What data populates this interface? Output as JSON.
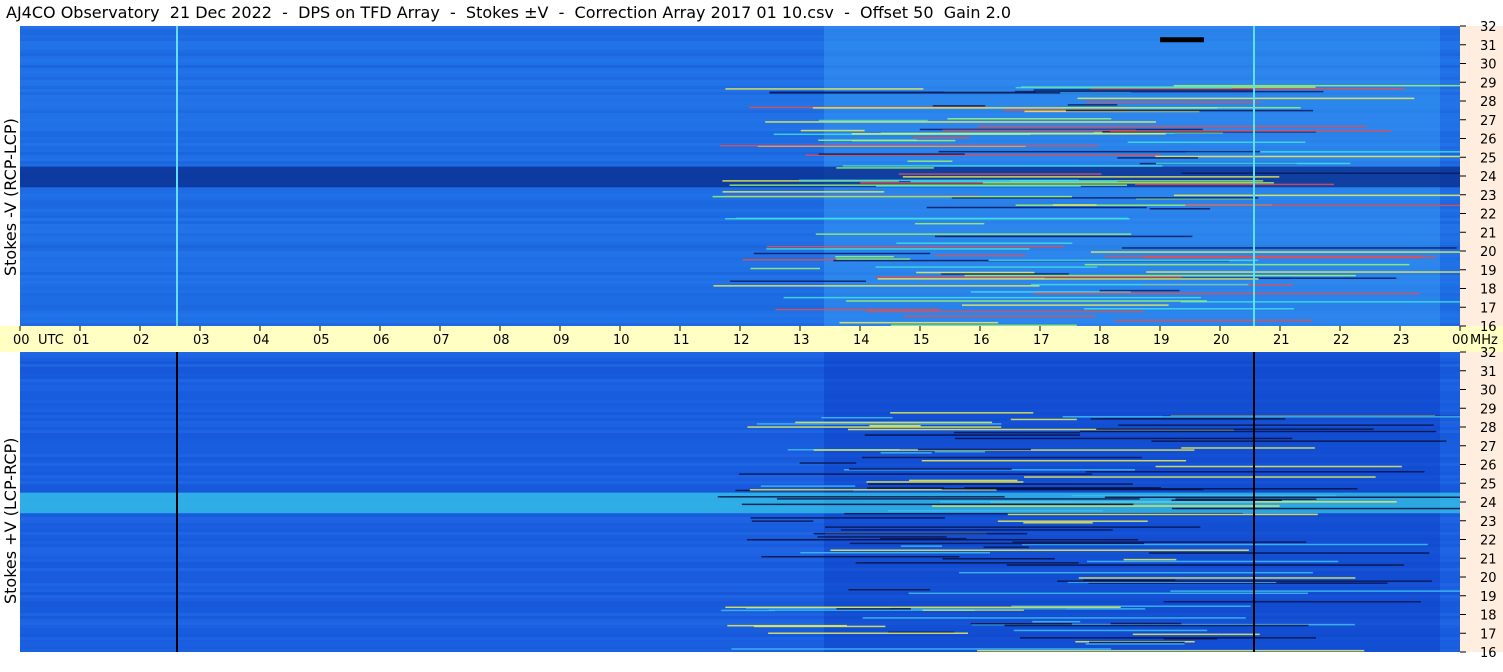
{
  "title": "AJ4CO Observatory  21 Dec 2022  -  DPS on TFD Array  -  Stokes ±V  -  Correction Array 2017 01 10.csv  -  Offset 50  Gain 2.0",
  "panels": {
    "top_label": "Stokes -V (RCP-LCP)",
    "bottom_label": "Stokes +V (LCP-RCP)"
  },
  "colors": {
    "top_base": "#1f6fe6",
    "bottom_base": "#1a5ee0",
    "timebar_bg": "#ffffc4",
    "right_axis_bg": "#ffeee0"
  },
  "chart_data": {
    "type": "heatmap",
    "title": "AJ4CO Observatory  21 Dec 2022  -  DPS on TFD Array  -  Stokes ±V  -  Correction Array 2017 01 10.csv  -  Offset 50  Gain 2.0",
    "x": {
      "unit": "UTC",
      "range": [
        0,
        24
      ],
      "tick_labels": [
        "00",
        "01",
        "02",
        "03",
        "04",
        "05",
        "06",
        "07",
        "08",
        "09",
        "10",
        "11",
        "12",
        "13",
        "14",
        "15",
        "16",
        "17",
        "18",
        "19",
        "20",
        "21",
        "22",
        "23",
        "00"
      ],
      "start_suffix": "UTC",
      "end_suffix": "MHz"
    },
    "y": {
      "unit": "MHz",
      "range": [
        16,
        32
      ],
      "tick_labels": [
        "16",
        "17",
        "18",
        "19",
        "20",
        "21",
        "22",
        "23",
        "24",
        "25",
        "26",
        "27",
        "28",
        "29",
        "30",
        "31",
        "32"
      ]
    },
    "series": [
      {
        "name": "Stokes -V (RCP-LCP)"
      },
      {
        "name": "Stokes +V (LCP-RCP)"
      }
    ]
  }
}
